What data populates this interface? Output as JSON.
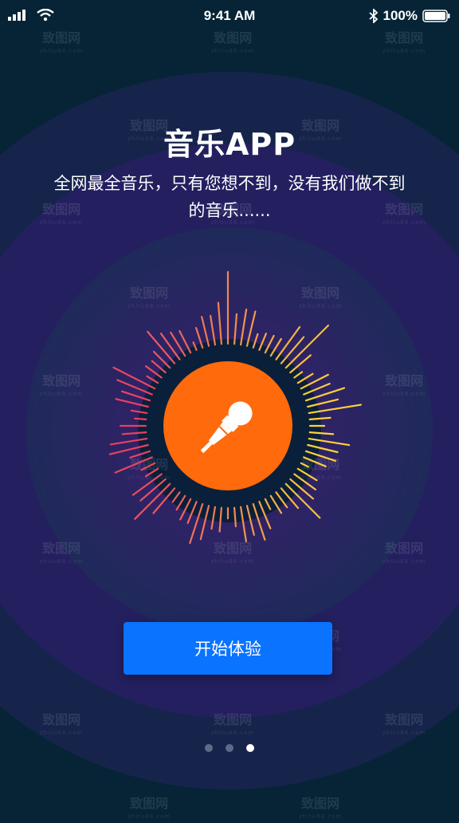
{
  "status_bar": {
    "time": "9:41 AM",
    "battery": "100%"
  },
  "icons": {
    "signal": "signal-bars-icon",
    "wifi": "wifi-icon",
    "bluetooth": "bluetooth-icon",
    "battery": "battery-icon",
    "microphone": "microphone-icon"
  },
  "header": {
    "title": "音乐APP",
    "subtitle": "全网最全音乐，只有您想不到，没有我们做不到的音乐......"
  },
  "cta": {
    "label": "开始体验"
  },
  "pagination": {
    "total": 3,
    "active": 3
  },
  "watermark": {
    "text": "致图网",
    "subtext": "zhitu88.com"
  },
  "colors": {
    "background": "#062436",
    "ring_outer": "#2b1f5e",
    "ring_inner": "#3b1f6e",
    "accent_orange": "#ff6a0c",
    "button_blue": "#0a73ff",
    "bar_gradient_start": "#e83f64",
    "bar_gradient_end": "#fcd23b"
  }
}
